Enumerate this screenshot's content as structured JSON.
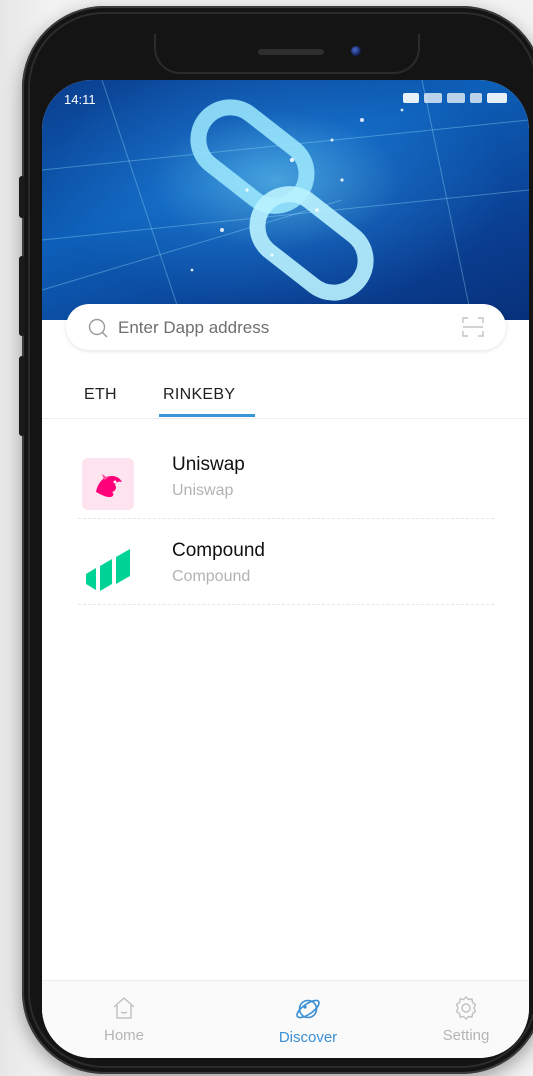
{
  "status_bar": {
    "time": "14:11"
  },
  "search": {
    "placeholder": "Enter Dapp address",
    "value": ""
  },
  "tabs": [
    {
      "label": "ETH",
      "active": false
    },
    {
      "label": "RINKEBY",
      "active": true
    }
  ],
  "dapps": [
    {
      "name": "Uniswap",
      "subtitle": "Uniswap",
      "icon": "uniswap-unicorn-logo"
    },
    {
      "name": "Compound",
      "subtitle": "Compound",
      "icon": "compound-logo"
    }
  ],
  "bottom_nav": [
    {
      "label": "Home",
      "icon": "home-icon",
      "active": false
    },
    {
      "label": "Discover",
      "icon": "planet-icon",
      "active": true
    },
    {
      "label": "Setting",
      "icon": "gear-icon",
      "active": false
    }
  ],
  "colors": {
    "accent": "#3b8fd4",
    "hero_blue": "#0d5fb8",
    "uniswap_pink": "#ff007a",
    "compound_green": "#00d395"
  }
}
